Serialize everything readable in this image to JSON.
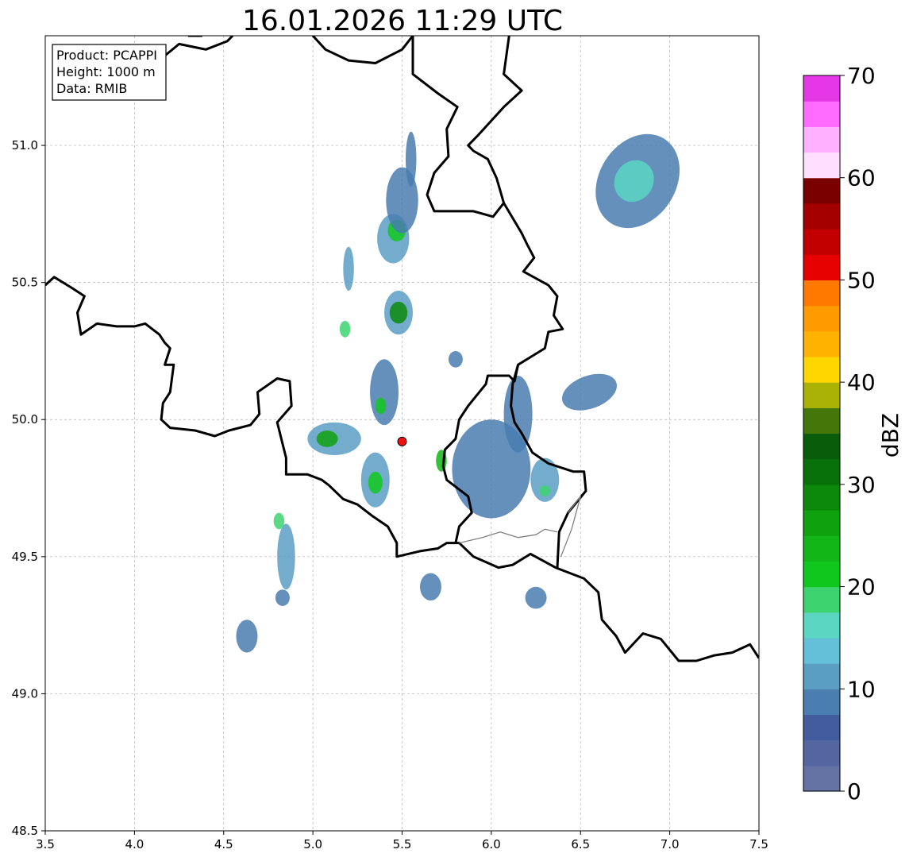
{
  "title": "16.01.2026 11:29 UTC",
  "info_box": {
    "product": "Product: PCAPPI",
    "height": "Height: 1000 m",
    "data": "Data: RMIB"
  },
  "map_extent": {
    "lon": [
      3.5,
      7.5
    ],
    "lat": [
      48.5,
      51.4
    ]
  },
  "x_ticks": [
    "3.5",
    "4.0",
    "4.5",
    "5.0",
    "5.5",
    "6.0",
    "6.5",
    "7.0",
    "7.5"
  ],
  "y_ticks": [
    "48.5",
    "49.0",
    "49.5",
    "50.0",
    "50.5",
    "51.0"
  ],
  "radar_site": {
    "lon": 5.5,
    "lat": 49.92,
    "color": "#ee1111"
  },
  "colorbar": {
    "label": "dBZ",
    "min": 0,
    "max": 70,
    "ticks": [
      "0",
      "10",
      "20",
      "30",
      "40",
      "50",
      "60",
      "70"
    ],
    "colors": [
      "#6472a4",
      "#5366a0",
      "#435c9f",
      "#4a7db0",
      "#5a9ec4",
      "#64c0d8",
      "#5ad6c2",
      "#3dd470",
      "#10c81d",
      "#12b616",
      "#10a10f",
      "#0c890b",
      "#077009",
      "#095c09",
      "#45760a",
      "#aab205",
      "#ffd600",
      "#ffb300",
      "#ff9a00",
      "#ff7800",
      "#e60000",
      "#c20000",
      "#a50000",
      "#7a0000",
      "#ffdfff",
      "#ffb0ff",
      "#ff6bff",
      "#e637e6"
    ]
  },
  "echoes": [
    {
      "lon": 6.82,
      "lat": 50.87,
      "rx": 0.28,
      "ry": 0.14,
      "rot": -58,
      "dbz": 8
    },
    {
      "lon": 6.8,
      "lat": 50.87,
      "rx": 0.12,
      "ry": 0.07,
      "rot": -58,
      "dbz": 16
    },
    {
      "lon": 5.12,
      "lat": 49.93,
      "rx": 0.15,
      "ry": 0.06,
      "rot": 0,
      "dbz": 11
    },
    {
      "lon": 5.08,
      "lat": 49.93,
      "rx": 0.06,
      "ry": 0.03,
      "rot": 0,
      "dbz": 27
    },
    {
      "lon": 5.45,
      "lat": 50.66,
      "rx": 0.09,
      "ry": 0.09,
      "rot": 0,
      "dbz": 10
    },
    {
      "lon": 5.47,
      "lat": 50.69,
      "rx": 0.05,
      "ry": 0.04,
      "rot": 0,
      "dbz": 22
    },
    {
      "lon": 5.48,
      "lat": 50.39,
      "rx": 0.08,
      "ry": 0.08,
      "rot": 0,
      "dbz": 10
    },
    {
      "lon": 5.48,
      "lat": 50.39,
      "rx": 0.05,
      "ry": 0.04,
      "rot": 0,
      "dbz": 28
    },
    {
      "lon": 5.5,
      "lat": 50.8,
      "rx": 0.09,
      "ry": 0.12,
      "rot": 0,
      "dbz": 9
    },
    {
      "lon": 5.8,
      "lat": 50.22,
      "rx": 0.04,
      "ry": 0.03,
      "rot": 0,
      "dbz": 8
    },
    {
      "lon": 5.4,
      "lat": 50.1,
      "rx": 0.08,
      "ry": 0.12,
      "rot": 0,
      "dbz": 9
    },
    {
      "lon": 5.38,
      "lat": 50.05,
      "rx": 0.03,
      "ry": 0.03,
      "rot": 0,
      "dbz": 21
    },
    {
      "lon": 5.35,
      "lat": 49.78,
      "rx": 0.08,
      "ry": 0.1,
      "rot": 0,
      "dbz": 10
    },
    {
      "lon": 5.35,
      "lat": 49.77,
      "rx": 0.04,
      "ry": 0.04,
      "rot": 0,
      "dbz": 22
    },
    {
      "lon": 6.0,
      "lat": 49.82,
      "rx": 0.22,
      "ry": 0.18,
      "rot": 0,
      "dbz": 8
    },
    {
      "lon": 6.15,
      "lat": 50.02,
      "rx": 0.08,
      "ry": 0.14,
      "rot": 0,
      "dbz": 9
    },
    {
      "lon": 6.3,
      "lat": 49.78,
      "rx": 0.08,
      "ry": 0.08,
      "rot": 0,
      "dbz": 11
    },
    {
      "lon": 6.3,
      "lat": 49.74,
      "rx": 0.03,
      "ry": 0.02,
      "rot": 0,
      "dbz": 19
    },
    {
      "lon": 6.55,
      "lat": 50.1,
      "rx": 0.16,
      "ry": 0.06,
      "rot": -20,
      "dbz": 8
    },
    {
      "lon": 4.85,
      "lat": 49.5,
      "rx": 0.05,
      "ry": 0.12,
      "rot": 0,
      "dbz": 10
    },
    {
      "lon": 4.81,
      "lat": 49.63,
      "rx": 0.03,
      "ry": 0.03,
      "rot": 0,
      "dbz": 18
    },
    {
      "lon": 4.63,
      "lat": 49.21,
      "rx": 0.06,
      "ry": 0.06,
      "rot": 0,
      "dbz": 8
    },
    {
      "lon": 5.66,
      "lat": 49.39,
      "rx": 0.06,
      "ry": 0.05,
      "rot": 0,
      "dbz": 9
    },
    {
      "lon": 6.25,
      "lat": 49.35,
      "rx": 0.06,
      "ry": 0.04,
      "rot": 0,
      "dbz": 9
    },
    {
      "lon": 5.2,
      "lat": 50.55,
      "rx": 0.03,
      "ry": 0.08,
      "rot": 0,
      "dbz": 10
    },
    {
      "lon": 5.72,
      "lat": 49.85,
      "rx": 0.03,
      "ry": 0.04,
      "rot": 0,
      "dbz": 23
    },
    {
      "lon": 5.55,
      "lat": 50.95,
      "rx": 0.03,
      "ry": 0.1,
      "rot": 0,
      "dbz": 8
    },
    {
      "lon": 5.18,
      "lat": 50.33,
      "rx": 0.03,
      "ry": 0.03,
      "rot": 0,
      "dbz": 18
    },
    {
      "lon": 4.83,
      "lat": 49.35,
      "rx": 0.04,
      "ry": 0.03,
      "rot": 0,
      "dbz": 9
    }
  ],
  "borders": [
    {
      "kind": "thick",
      "points": [
        [
          3.5,
          50.49
        ],
        [
          3.55,
          50.52
        ],
        [
          3.65,
          50.48
        ],
        [
          3.72,
          50.45
        ],
        [
          3.68,
          50.39
        ],
        [
          3.7,
          50.31
        ],
        [
          3.79,
          50.35
        ],
        [
          3.9,
          50.34
        ],
        [
          4.0,
          50.34
        ],
        [
          4.06,
          50.35
        ],
        [
          4.14,
          50.31
        ],
        [
          4.17,
          50.28
        ],
        [
          4.2,
          50.26
        ],
        [
          4.17,
          50.2
        ],
        [
          4.22,
          50.2
        ],
        [
          4.2,
          50.1
        ],
        [
          4.16,
          50.06
        ],
        [
          4.15,
          50.0
        ],
        [
          4.2,
          49.97
        ],
        [
          4.34,
          49.96
        ],
        [
          4.45,
          49.94
        ],
        [
          4.53,
          49.96
        ],
        [
          4.65,
          49.98
        ],
        [
          4.7,
          50.02
        ],
        [
          4.69,
          50.1
        ],
        [
          4.8,
          50.15
        ],
        [
          4.87,
          50.14
        ],
        [
          4.88,
          50.05
        ],
        [
          4.8,
          49.99
        ],
        [
          4.85,
          49.86
        ],
        [
          4.85,
          49.8
        ],
        [
          4.97,
          49.8
        ],
        [
          5.05,
          49.78
        ],
        [
          5.09,
          49.76
        ],
        [
          5.17,
          49.71
        ],
        [
          5.25,
          49.69
        ],
        [
          5.33,
          49.65
        ],
        [
          5.42,
          49.61
        ],
        [
          5.47,
          49.55
        ],
        [
          5.47,
          49.5
        ],
        [
          5.6,
          49.52
        ],
        [
          5.7,
          49.53
        ],
        [
          5.75,
          49.55
        ],
        [
          5.82,
          49.55
        ],
        [
          5.9,
          49.5
        ],
        [
          6.04,
          49.46
        ],
        [
          6.12,
          49.47
        ],
        [
          6.22,
          49.51
        ],
        [
          6.36,
          49.46
        ],
        [
          6.52,
          49.42
        ],
        [
          6.6,
          49.37
        ],
        [
          6.62,
          49.27
        ],
        [
          6.7,
          49.21
        ],
        [
          6.75,
          49.15
        ],
        [
          6.85,
          49.22
        ],
        [
          6.95,
          49.2
        ],
        [
          7.05,
          49.12
        ],
        [
          7.15,
          49.12
        ],
        [
          7.25,
          49.14
        ],
        [
          7.35,
          49.15
        ],
        [
          7.45,
          49.18
        ],
        [
          7.5,
          49.13
        ]
      ]
    },
    {
      "kind": "thick",
      "points": [
        [
          4.55,
          51.4
        ],
        [
          4.52,
          51.38
        ],
        [
          4.4,
          51.35
        ],
        [
          4.25,
          51.37
        ],
        [
          4.12,
          51.3
        ],
        [
          4.0,
          51.3
        ],
        [
          3.9,
          51.28
        ],
        [
          3.8,
          51.27
        ],
        [
          3.65,
          51.24
        ]
      ]
    },
    {
      "kind": "thick",
      "points": [
        [
          4.3,
          51.4
        ],
        [
          4.38,
          51.4
        ]
      ]
    },
    {
      "kind": "thick",
      "points": [
        [
          5.56,
          51.4
        ],
        [
          5.5,
          51.35
        ],
        [
          5.35,
          51.3
        ],
        [
          5.2,
          51.31
        ],
        [
          5.07,
          51.35
        ],
        [
          5.0,
          51.4
        ]
      ]
    },
    {
      "kind": "thick",
      "points": [
        [
          6.1,
          51.4
        ],
        [
          6.07,
          51.26
        ],
        [
          6.17,
          51.2
        ],
        [
          6.07,
          51.14
        ],
        [
          5.93,
          51.04
        ],
        [
          5.87,
          51.0
        ],
        [
          5.9,
          50.98
        ],
        [
          5.98,
          50.95
        ],
        [
          6.03,
          50.88
        ],
        [
          6.07,
          50.79
        ],
        [
          6.01,
          50.74
        ],
        [
          5.9,
          50.76
        ],
        [
          5.8,
          50.76
        ],
        [
          5.68,
          50.76
        ],
        [
          5.64,
          50.82
        ],
        [
          5.68,
          50.9
        ],
        [
          5.76,
          50.96
        ],
        [
          5.75,
          51.06
        ],
        [
          5.81,
          51.14
        ],
        [
          5.7,
          51.19
        ],
        [
          5.56,
          51.26
        ],
        [
          5.56,
          51.4
        ]
      ]
    },
    {
      "kind": "thick",
      "points": [
        [
          6.07,
          50.79
        ],
        [
          6.17,
          50.68
        ],
        [
          6.2,
          50.64
        ],
        [
          6.24,
          50.59
        ],
        [
          6.18,
          50.54
        ],
        [
          6.32,
          50.49
        ],
        [
          6.37,
          50.45
        ],
        [
          6.35,
          50.38
        ],
        [
          6.4,
          50.33
        ],
        [
          6.32,
          50.32
        ],
        [
          6.3,
          50.26
        ],
        [
          6.25,
          50.24
        ],
        [
          6.15,
          50.2
        ],
        [
          6.13,
          50.14
        ],
        [
          6.1,
          50.16
        ],
        [
          6.04,
          50.16
        ],
        [
          5.98,
          50.16
        ],
        [
          5.97,
          50.13
        ],
        [
          5.87,
          50.05
        ],
        [
          5.82,
          50.0
        ],
        [
          5.8,
          49.93
        ],
        [
          5.74,
          49.89
        ],
        [
          5.73,
          49.83
        ],
        [
          5.75,
          49.78
        ],
        [
          5.87,
          49.72
        ],
        [
          5.89,
          49.66
        ],
        [
          5.82,
          49.61
        ],
        [
          5.8,
          49.55
        ]
      ]
    },
    {
      "kind": "thick",
      "points": [
        [
          6.15,
          50.2
        ],
        [
          6.12,
          50.13
        ],
        [
          6.11,
          50.05
        ],
        [
          6.13,
          49.99
        ],
        [
          6.17,
          49.95
        ],
        [
          6.23,
          49.88
        ],
        [
          6.32,
          49.84
        ],
        [
          6.46,
          49.81
        ],
        [
          6.52,
          49.81
        ],
        [
          6.53,
          49.74
        ],
        [
          6.43,
          49.66
        ],
        [
          6.38,
          49.59
        ],
        [
          6.37,
          49.46
        ]
      ]
    },
    {
      "kind": "thin",
      "points": [
        [
          5.82,
          49.55
        ],
        [
          5.95,
          49.57
        ],
        [
          6.05,
          49.59
        ],
        [
          6.15,
          49.57
        ],
        [
          6.25,
          49.58
        ],
        [
          6.3,
          49.6
        ],
        [
          6.37,
          49.59
        ]
      ]
    },
    {
      "kind": "thin",
      "points": [
        [
          6.43,
          49.66
        ],
        [
          6.5,
          49.72
        ],
        [
          6.45,
          49.6
        ],
        [
          6.39,
          49.5
        ]
      ]
    }
  ]
}
